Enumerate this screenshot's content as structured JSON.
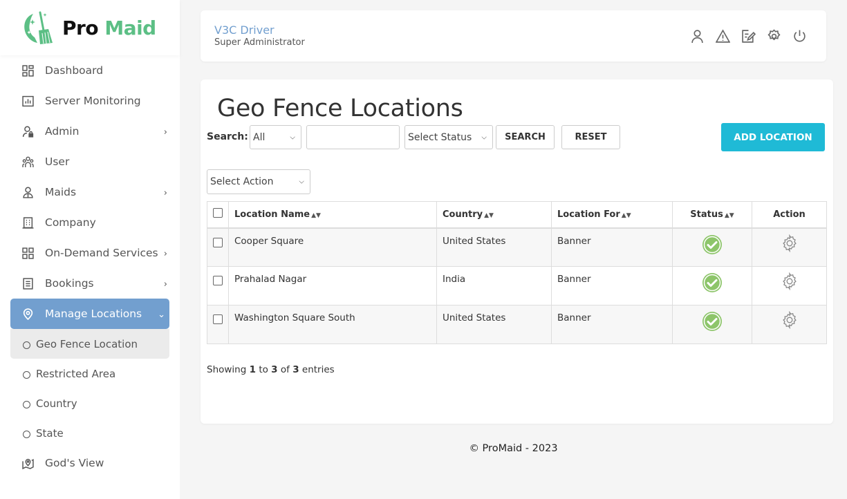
{
  "brand": {
    "name_part1": "Pro",
    "name_part2": "Maid",
    "primary_color": "#5cbf85"
  },
  "sidebar": {
    "items": [
      {
        "label": "Dashboard",
        "icon": "dashboard-icon",
        "has_children": false
      },
      {
        "label": "Server Monitoring",
        "icon": "chart-icon",
        "has_children": false
      },
      {
        "label": "Admin",
        "icon": "user-lock-icon",
        "has_children": true
      },
      {
        "label": "User",
        "icon": "users-icon",
        "has_children": false
      },
      {
        "label": "Maids",
        "icon": "maid-icon",
        "has_children": true
      },
      {
        "label": "Company",
        "icon": "building-icon",
        "has_children": false
      },
      {
        "label": "On-Demand Services",
        "icon": "grid-icon",
        "has_children": true
      },
      {
        "label": "Bookings",
        "icon": "list-icon",
        "has_children": true
      },
      {
        "label": "Manage Locations",
        "icon": "location-pin-icon",
        "has_children": true,
        "active": true
      }
    ],
    "sub_items": [
      {
        "label": "Geo Fence Location",
        "current": true
      },
      {
        "label": "Restricted Area"
      },
      {
        "label": "Country"
      },
      {
        "label": "State"
      }
    ],
    "last_item": {
      "label": "God's View",
      "icon": "map-icon"
    },
    "active_color": "#729fcf"
  },
  "header": {
    "user_name": "V3C Driver",
    "user_role": "Super Administrator",
    "icons": [
      "profile-icon",
      "alert-icon",
      "edit-icon",
      "settings-icon",
      "power-icon"
    ]
  },
  "main": {
    "title": "Geo Fence Locations",
    "search_label": "Search:",
    "search_field_select": "All",
    "search_input_value": "",
    "status_select": "Select Status",
    "search_button": "SEARCH",
    "reset_button": "RESET",
    "add_button": "ADD LOCATION",
    "add_button_color": "#1fbad6",
    "action_select": "Select Action",
    "table": {
      "columns": [
        "Location Name",
        "Country",
        "Location For",
        "Status",
        "Action"
      ],
      "rows": [
        {
          "name": "Cooper Square",
          "country": "United States",
          "location_for": "Banner",
          "status": "active"
        },
        {
          "name": "Prahalad Nagar",
          "country": "India",
          "location_for": "Banner",
          "status": "active"
        },
        {
          "name": "Washington Square South",
          "country": "United States",
          "location_for": "Banner",
          "status": "active"
        }
      ]
    },
    "info": {
      "prefix": "Showing",
      "from": "1",
      "to_word": "to",
      "to": "3",
      "of_word": "of",
      "total": "3",
      "suffix": "entries"
    }
  },
  "footer": {
    "text": "© ProMaid - 2023"
  }
}
